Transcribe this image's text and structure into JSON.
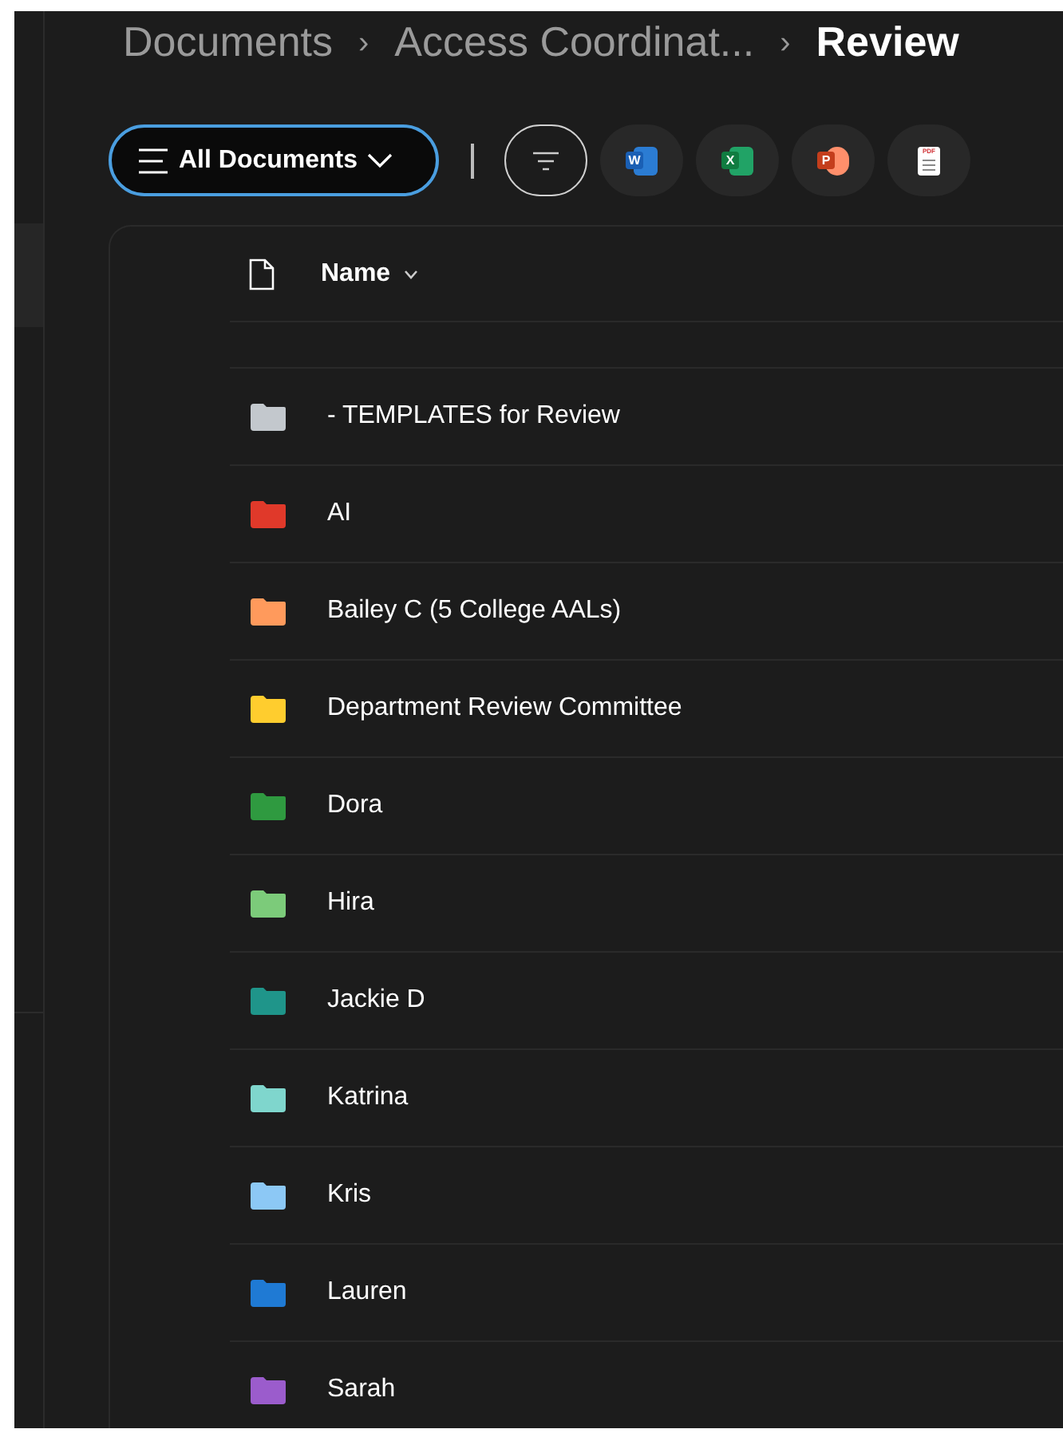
{
  "breadcrumb": [
    {
      "label": "Documents",
      "current": false
    },
    {
      "label": "Access Coordinat...",
      "current": false
    },
    {
      "label": "Review",
      "current": true
    }
  ],
  "separator": "›",
  "view_button": {
    "label": "All Documents"
  },
  "new_buttons": [
    {
      "kind": "word",
      "letter": "W"
    },
    {
      "kind": "excel",
      "letter": "X"
    },
    {
      "kind": "powerpoint",
      "letter": "P"
    },
    {
      "kind": "pdf",
      "letter": "PDF"
    }
  ],
  "table": {
    "columns": [
      {
        "label": "Name",
        "sorted": true
      }
    ],
    "rows": [
      {
        "name": "- TEMPLATES for Review",
        "color": "#c3c8cd"
      },
      {
        "name": "AI",
        "color": "#e0392a"
      },
      {
        "name": "Bailey C (5 College AALs)",
        "color": "#ff9a5c"
      },
      {
        "name": "Department Review Committee",
        "color": "#ffcd2e"
      },
      {
        "name": "Dora",
        "color": "#2f9a40"
      },
      {
        "name": "Hira",
        "color": "#7ccb7a"
      },
      {
        "name": "Jackie D",
        "color": "#1f958a"
      },
      {
        "name": "Katrina",
        "color": "#7fd6cd"
      },
      {
        "name": "Kris",
        "color": "#8cc8f5"
      },
      {
        "name": "Lauren",
        "color": "#1f7ad4"
      },
      {
        "name": "Sarah",
        "color": "#9b5ccc"
      }
    ]
  }
}
